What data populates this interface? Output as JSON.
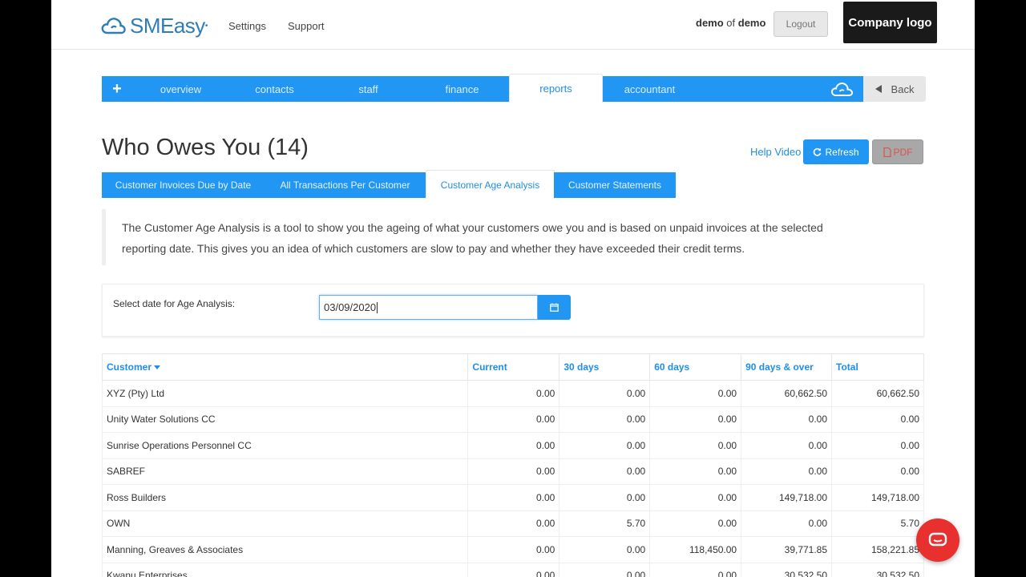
{
  "header": {
    "logo_text": "SMEasy",
    "nav": [
      "Settings",
      "Support"
    ],
    "user_name": "demo",
    "user_of": "of",
    "user_org": "demo",
    "logout_label": "Logout",
    "company_logo_label": "Company logo"
  },
  "mainnav": {
    "items": [
      "overview",
      "contacts",
      "staff",
      "finance",
      "reports",
      "accountant"
    ],
    "active": "reports",
    "back_label": "Back"
  },
  "page": {
    "title": "Who Owes You (14)",
    "help_video": "Help Video",
    "refresh_label": "Refresh",
    "pdf_label": "PDF"
  },
  "subtabs": [
    "Customer Invoices Due by Date",
    "All Transactions Per Customer",
    "Customer Age Analysis",
    "Customer Statements"
  ],
  "description": {
    "line1": "The Customer Age Analysis is a tool to show you the ageing of what your customers owe you and is based on unpaid invoices at the selected",
    "line2": "reporting date. This gives you an idea of which customers are slow to pay and whether they have exceeded their credit terms."
  },
  "date_panel": {
    "label": "Select date for Age Analysis:",
    "value": "03/09/2020"
  },
  "table": {
    "headers": [
      "Customer",
      "Current",
      "30 days",
      "60 days",
      "90 days & over",
      "Total"
    ],
    "rows": [
      [
        "XYZ (Pty) Ltd",
        "0.00",
        "0.00",
        "0.00",
        "60,662.50",
        "60,662.50"
      ],
      [
        "Unity Water Solutions CC",
        "0.00",
        "0.00",
        "0.00",
        "0.00",
        "0.00"
      ],
      [
        "Sunrise Operations Personnel CC",
        "0.00",
        "0.00",
        "0.00",
        "0.00",
        "0.00"
      ],
      [
        "SABREF",
        "0.00",
        "0.00",
        "0.00",
        "0.00",
        "0.00"
      ],
      [
        "Ross Builders",
        "0.00",
        "0.00",
        "0.00",
        "149,718.00",
        "149,718.00"
      ],
      [
        "OWN",
        "0.00",
        "5.70",
        "0.00",
        "0.00",
        "5.70"
      ],
      [
        "Manning, Greaves & Associates",
        "0.00",
        "0.00",
        "118,450.00",
        "39,771.85",
        "158,221.85"
      ],
      [
        "Kwanu Enterprises",
        "0.00",
        "0.00",
        "0.00",
        "30,532.50",
        "30,532.50"
      ]
    ]
  },
  "colors": {
    "primary": "#2196f3",
    "link": "#1f8ee8",
    "chat": "#e8302f"
  }
}
